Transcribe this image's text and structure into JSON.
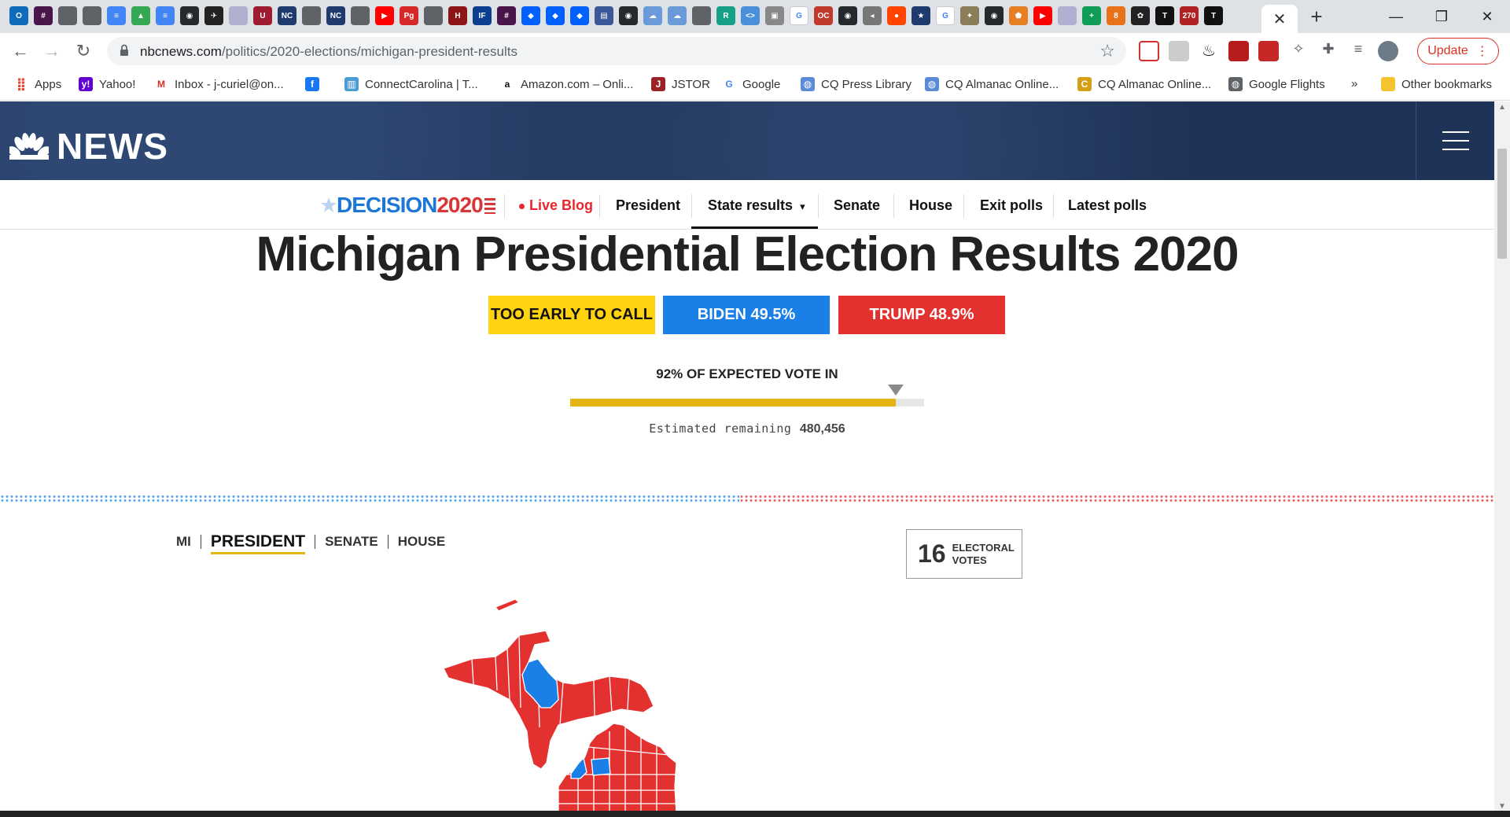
{
  "browser": {
    "url_host": "nbcnews.com",
    "url_path": "/politics/2020-elections/michigan-president-results",
    "update_label": "Update",
    "close_tab_glyph": "✕",
    "new_tab_glyph": "+",
    "tab_favicons": [
      {
        "icon": "outlook-icon",
        "color": "#0f6cbd",
        "text": "O"
      },
      {
        "icon": "slack-icon",
        "color": "#4a154b",
        "text": "#"
      },
      {
        "icon": "generic-site-icon",
        "color": "#5f6368",
        "text": ""
      },
      {
        "icon": "generic-site-icon",
        "color": "#5f6368",
        "text": ""
      },
      {
        "icon": "google-docs-icon",
        "color": "#4285f4",
        "text": "≡"
      },
      {
        "icon": "google-drive-icon",
        "color": "#34a853",
        "text": "▲"
      },
      {
        "icon": "google-docs-icon",
        "color": "#4285f4",
        "text": "≡"
      },
      {
        "icon": "github-icon",
        "color": "#24292e",
        "text": "◉"
      },
      {
        "icon": "bird-icon",
        "color": "#222222",
        "text": "✈"
      },
      {
        "icon": "dotted-icon",
        "color": "#b0b0d0",
        "text": ""
      },
      {
        "icon": "university-icon",
        "color": "#9e1b32",
        "text": "U"
      },
      {
        "icon": "nc-icon",
        "color": "#1e3a6e",
        "text": "NC"
      },
      {
        "icon": "generic-site-icon",
        "color": "#5f6368",
        "text": ""
      },
      {
        "icon": "nc-icon",
        "color": "#1e3a6e",
        "text": "NC"
      },
      {
        "icon": "generic-site-icon",
        "color": "#5f6368",
        "text": ""
      },
      {
        "icon": "youtube-icon",
        "color": "#ff0000",
        "text": "▶"
      },
      {
        "icon": "pg-icon",
        "color": "#d62828",
        "text": "Pg"
      },
      {
        "icon": "generic-site-icon",
        "color": "#5f6368",
        "text": ""
      },
      {
        "icon": "university-icon",
        "color": "#8c1515",
        "text": "H"
      },
      {
        "icon": "ifes-icon",
        "color": "#0b3d91",
        "text": "IF"
      },
      {
        "icon": "slack-icon",
        "color": "#4a154b",
        "text": "#"
      },
      {
        "icon": "dropbox-icon",
        "color": "#0061ff",
        "text": "◆"
      },
      {
        "icon": "dropbox-icon",
        "color": "#0061ff",
        "text": "◆"
      },
      {
        "icon": "dropbox-icon",
        "color": "#0061ff",
        "text": "◆"
      },
      {
        "icon": "building-icon",
        "color": "#3b5998",
        "text": "▤"
      },
      {
        "icon": "github-icon",
        "color": "#24292e",
        "text": "◉"
      },
      {
        "icon": "cloud-icon",
        "color": "#6a9bd8",
        "text": "☁"
      },
      {
        "icon": "cloud-icon",
        "color": "#6a9bd8",
        "text": "☁"
      },
      {
        "icon": "generic-site-icon",
        "color": "#5f6368",
        "text": ""
      },
      {
        "icon": "r-icon",
        "color": "#16a085",
        "text": "R"
      },
      {
        "icon": "code-icon",
        "color": "#4a90d9",
        "text": "<>"
      },
      {
        "icon": "image-icon",
        "color": "#888888",
        "text": "▣"
      },
      {
        "icon": "google-icon",
        "color": "#ffffff",
        "text": "G"
      },
      {
        "icon": "ocj-icon",
        "color": "#c0392b",
        "text": "OC"
      },
      {
        "icon": "github-icon",
        "color": "#24292e",
        "text": "◉"
      },
      {
        "icon": "speaker-icon",
        "color": "#777777",
        "text": "◂"
      },
      {
        "icon": "reddit-icon",
        "color": "#ff4500",
        "text": "●"
      },
      {
        "icon": "star-badge-icon",
        "color": "#1e3a6e",
        "text": "★"
      },
      {
        "icon": "google-icon",
        "color": "#ffffff",
        "text": "G"
      },
      {
        "icon": "seal-icon",
        "color": "#8b7d5a",
        "text": "✦"
      },
      {
        "icon": "github-icon",
        "color": "#24292e",
        "text": "◉"
      },
      {
        "icon": "shield-icon",
        "color": "#e67e22",
        "text": "⬟"
      },
      {
        "icon": "youtube-icon",
        "color": "#ff0000",
        "text": "▶"
      },
      {
        "icon": "dotted-icon",
        "color": "#b0b0d0",
        "text": ""
      },
      {
        "icon": "plus-green-icon",
        "color": "#0f9d58",
        "text": "+"
      },
      {
        "icon": "pin-icon",
        "color": "#e8711a",
        "text": "8"
      },
      {
        "icon": "nbc-peacock-icon",
        "color": "#222222",
        "text": "✿"
      },
      {
        "icon": "nyt-icon",
        "color": "#111111",
        "text": "T"
      },
      {
        "icon": "flag-270-icon",
        "color": "#b22222",
        "text": "270"
      },
      {
        "icon": "nyt-icon",
        "color": "#111111",
        "text": "T"
      }
    ]
  },
  "bookmarks": [
    {
      "label": "Apps",
      "icon": "apps-grid-icon",
      "color": "#ea4335",
      "glyph": "⣿"
    },
    {
      "label": "Yahoo!",
      "icon": "yahoo-icon",
      "color": "#6001d2",
      "glyph": "y!"
    },
    {
      "label": "Inbox - j-curiel@on...",
      "icon": "gmail-icon",
      "color": "#ffffff",
      "glyph": "M"
    },
    {
      "label": "",
      "icon": "facebook-icon",
      "color": "#1877f2",
      "glyph": "f"
    },
    {
      "label": "ConnectCarolina | T...",
      "icon": "building-icon",
      "color": "#4b9cd3",
      "glyph": "▥"
    },
    {
      "label": "Amazon.com – Onli...",
      "icon": "amazon-icon",
      "color": "#ffffff",
      "glyph": "a"
    },
    {
      "label": "JSTOR",
      "icon": "jstor-icon",
      "color": "#9b2226",
      "glyph": "J"
    },
    {
      "label": "Google",
      "icon": "google-icon",
      "color": "#ffffff",
      "glyph": "G"
    },
    {
      "label": "CQ Press Library",
      "icon": "globe-icon",
      "color": "#5b8bd6",
      "glyph": "◍"
    },
    {
      "label": "CQ Almanac Online...",
      "icon": "globe-icon",
      "color": "#5b8bd6",
      "glyph": "◍"
    },
    {
      "label": "CQ Almanac Online...",
      "icon": "cq-icon",
      "color": "#d4a017",
      "glyph": "C"
    },
    {
      "label": "Google Flights",
      "icon": "globe-icon",
      "color": "#5f6368",
      "glyph": "◍"
    },
    {
      "label": "»",
      "icon": "more-bookmarks-icon",
      "color": "",
      "glyph": ""
    },
    {
      "label": "Other bookmarks",
      "icon": "folder-icon",
      "color": "#f4c430",
      "glyph": ""
    }
  ],
  "header": {
    "brand": "NEWS"
  },
  "subnav": {
    "decision_part1": "DECISION",
    "decision_part2": "2020",
    "items": [
      {
        "label": "Live Blog"
      },
      {
        "label": "President"
      },
      {
        "label": "State results"
      },
      {
        "label": "Senate"
      },
      {
        "label": "House"
      },
      {
        "label": "Exit polls"
      },
      {
        "label": "Latest polls"
      }
    ]
  },
  "main": {
    "title": "Michigan Presidential Election Results 2020",
    "status_call": "TOO EARLY TO CALL",
    "biden": "BIDEN 49.5%",
    "trump": "TRUMP 48.9%",
    "expected_vote": "92% OF EXPECTED VOTE IN",
    "expected_fraction": 0.92,
    "remaining_label": "Estimated remaining",
    "remaining_value": "480,456",
    "race_tabs": [
      "MI",
      "PRESIDENT",
      "SENATE",
      "HOUSE"
    ],
    "selected_race": "PRESIDENT",
    "electoral_votes": "16",
    "electoral_label_1": "ELECTORAL",
    "electoral_label_2": "VOTES"
  },
  "colors": {
    "dem": "#1a7fe6",
    "rep": "#e3312f",
    "call": "#ffd30f",
    "progress": "#e5b514",
    "nbc_navy": "#1f3257"
  }
}
